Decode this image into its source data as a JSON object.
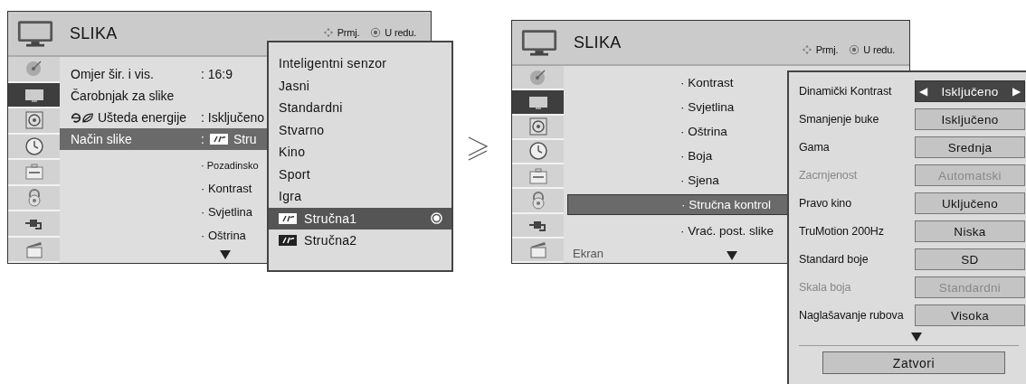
{
  "left_menu": {
    "title": "SLIKA",
    "hints": [
      {
        "kind": "move",
        "label": "Prmj."
      },
      {
        "kind": "ok",
        "label": "U redu."
      }
    ],
    "sidebar": [
      {
        "kind": "satellite",
        "selected": false
      },
      {
        "kind": "tv",
        "selected": true
      },
      {
        "kind": "speaker",
        "selected": false
      },
      {
        "kind": "clock",
        "selected": false
      },
      {
        "kind": "toolbox",
        "selected": false
      },
      {
        "kind": "lock",
        "selected": false
      },
      {
        "kind": "plug",
        "selected": false
      },
      {
        "kind": "clapper",
        "selected": false
      }
    ],
    "rows": [
      {
        "label": "Omjer šir. i vis.",
        "value": ": 16:9",
        "selected": false
      },
      {
        "label": "Čarobnjak za slike",
        "selected": false
      },
      {
        "label": "Ušteda energije",
        "value": ": Isključeno",
        "eco": true,
        "selected": false
      },
      {
        "label": "Način slike",
        "colon": ":",
        "value": "Stru",
        "logo": true,
        "selected": true
      }
    ],
    "subitems": [
      "· Pozadinsko",
      "· Kontrast",
      "· Svjetlina",
      "· Oštrina"
    ]
  },
  "picture_mode_menu": {
    "items": [
      {
        "label": "Inteligentni senzor",
        "selected": false
      },
      {
        "label": "Jasni",
        "selected": false
      },
      {
        "label": "Standardni",
        "selected": false
      },
      {
        "label": "Stvarno",
        "selected": false
      },
      {
        "label": "Kino",
        "selected": false
      },
      {
        "label": "Sport",
        "selected": false
      },
      {
        "label": "Igra",
        "selected": false
      },
      {
        "label": "Stručna1",
        "logo": true,
        "selected": true
      },
      {
        "label": "Stručna2",
        "logo": true,
        "selected": false
      }
    ]
  },
  "right_menu": {
    "title": "SLIKA",
    "hints": [
      {
        "kind": "move",
        "label": "Prmj."
      },
      {
        "kind": "ok",
        "label": "U redu."
      }
    ],
    "sidebar": [
      {
        "kind": "satellite",
        "selected": false
      },
      {
        "kind": "tv",
        "selected": true
      },
      {
        "kind": "speaker",
        "selected": false
      },
      {
        "kind": "clock",
        "selected": false
      },
      {
        "kind": "toolbox",
        "selected": false
      },
      {
        "kind": "lock",
        "selected": false
      },
      {
        "kind": "plug",
        "selected": false
      },
      {
        "kind": "clapper",
        "selected": false
      }
    ],
    "items": [
      {
        "kind": "sub",
        "label": "· Kontrast",
        "selected": false
      },
      {
        "kind": "sub",
        "label": "· Svjetlina",
        "selected": false
      },
      {
        "kind": "sub",
        "label": "· Oštrina",
        "selected": false
      },
      {
        "kind": "sub",
        "label": "· Boja",
        "selected": false
      },
      {
        "kind": "sub",
        "label": "· Sjena",
        "selected": false
      },
      {
        "kind": "sub",
        "label": "· Stručna kontrol",
        "selected": true
      },
      {
        "kind": "sub",
        "label": "· Vrać. post. slike",
        "selected": false
      },
      {
        "kind": "section",
        "label": "Ekran",
        "selected": false
      }
    ]
  },
  "expert_panel": {
    "rows": [
      {
        "label": "Dinamički Kontrast",
        "value": "Isključeno",
        "selected": true,
        "disabled": false
      },
      {
        "label": "Smanjenje buke",
        "value": "Isključeno",
        "selected": false,
        "disabled": false
      },
      {
        "label": "Gama",
        "value": "Srednja",
        "selected": false,
        "disabled": false
      },
      {
        "label": "Zacrnjenost",
        "value": "Automatski",
        "selected": false,
        "disabled": true
      },
      {
        "label": "Pravo kino",
        "value": "Uključeno",
        "selected": false,
        "disabled": false
      },
      {
        "label": "TruMotion 200Hz",
        "value": "Niska",
        "selected": false,
        "disabled": false
      },
      {
        "label": "Standard boje",
        "value": "SD",
        "selected": false,
        "disabled": false
      },
      {
        "label": "Skala boja",
        "value": "Standardni",
        "selected": false,
        "disabled": true
      },
      {
        "label": "Naglašavanje rubova",
        "value": "Visoka",
        "selected": false,
        "disabled": false
      }
    ],
    "left_arrow": "◀",
    "right_arrow": "▶",
    "close_button": "Zatvori"
  }
}
